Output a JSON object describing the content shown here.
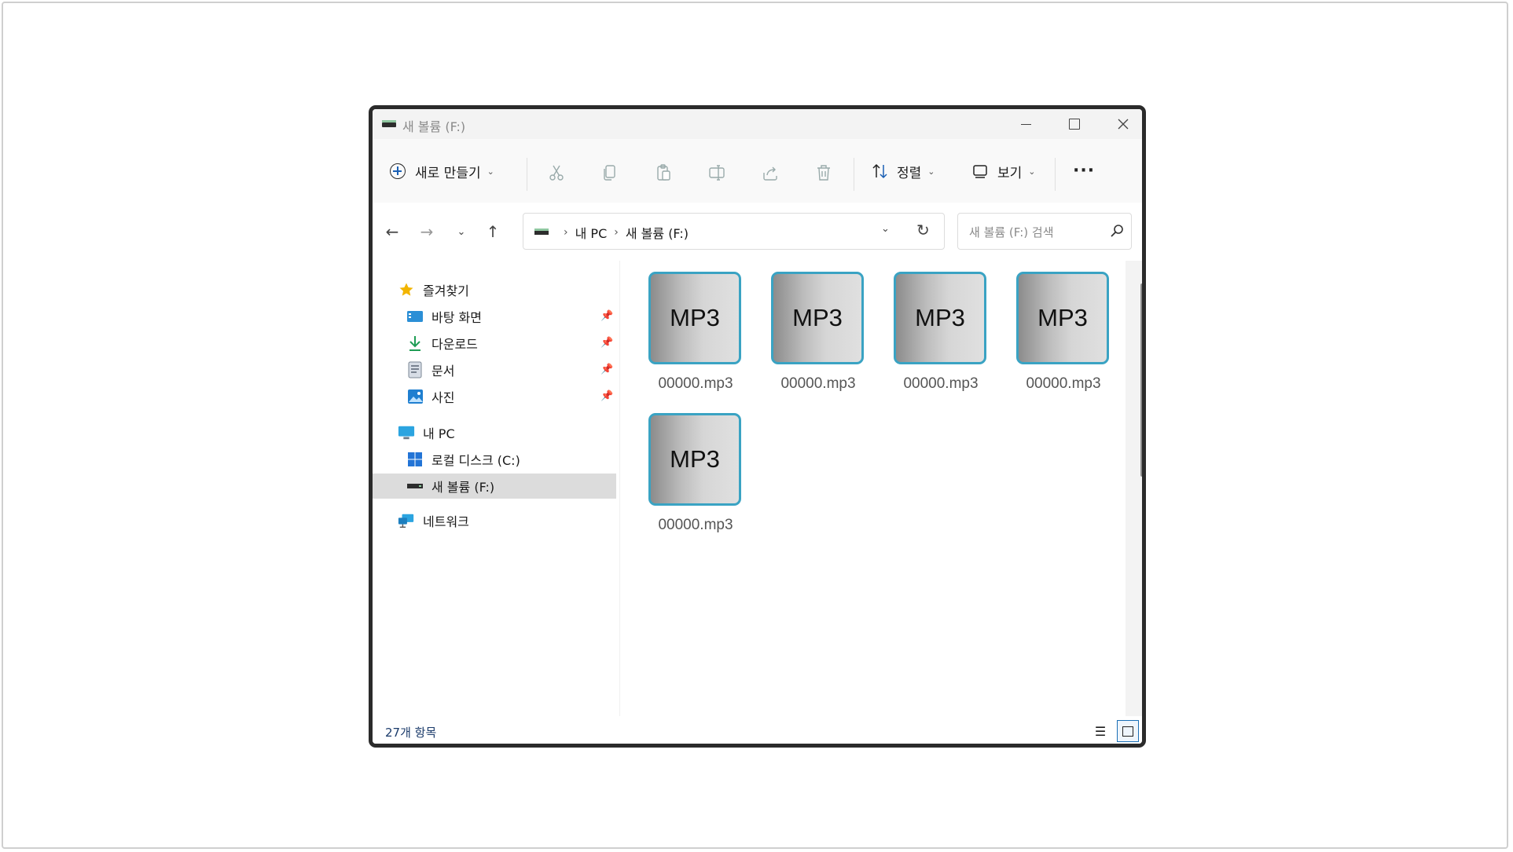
{
  "window": {
    "title": "새 볼륨 (F:)",
    "controls": {
      "minimize": "minimize",
      "maximize": "maximize",
      "close": "close"
    }
  },
  "toolbar": {
    "new_label": "새로 만들기",
    "sort_label": "정렬",
    "view_label": "보기",
    "more_label": "···",
    "icons": [
      "cut-icon",
      "copy-icon",
      "paste-icon",
      "rename-icon",
      "share-icon",
      "delete-icon"
    ]
  },
  "address": {
    "crumbs": [
      "내 PC",
      "새 볼륨 (F:)"
    ],
    "search_placeholder": "새 볼륨 (F:) 검색"
  },
  "sidebar": {
    "items": [
      {
        "label": "즐겨찾기",
        "icon": "star-icon"
      },
      {
        "label": "바탕 화면",
        "icon": "desktop-icon",
        "pinned": true
      },
      {
        "label": "다운로드",
        "icon": "download-icon",
        "pinned": true
      },
      {
        "label": "문서",
        "icon": "document-icon",
        "pinned": true
      },
      {
        "label": "사진",
        "icon": "pictures-icon",
        "pinned": true
      },
      {
        "label": "내 PC",
        "icon": "computer-icon"
      },
      {
        "label": "로컬 디스크 (C:)",
        "icon": "windows-drive-icon"
      },
      {
        "label": "새 볼륨 (F:)",
        "icon": "drive-icon",
        "selected": true
      },
      {
        "label": "네트워크",
        "icon": "network-icon"
      }
    ]
  },
  "files": [
    {
      "badge": "MP3",
      "name": "00000.mp3"
    },
    {
      "badge": "MP3",
      "name": "00000.mp3"
    },
    {
      "badge": "MP3",
      "name": "00000.mp3"
    },
    {
      "badge": "MP3",
      "name": "00000.mp3"
    },
    {
      "badge": "MP3",
      "name": "00000.mp3"
    }
  ],
  "status": {
    "item_count": "27개 항목"
  },
  "colors": {
    "tile_border": "#3aa3c3",
    "selection": "#dcdcdc",
    "accent": "#1a6fb5"
  }
}
